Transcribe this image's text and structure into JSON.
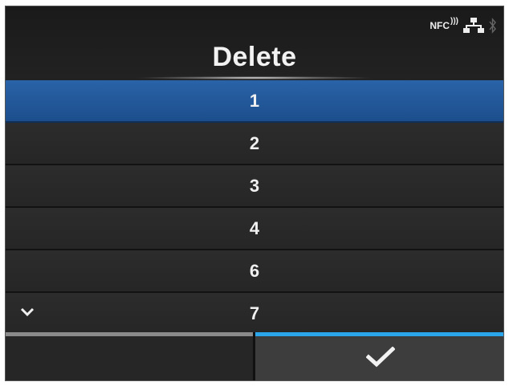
{
  "header": {
    "title": "Delete",
    "status": {
      "nfc_label": "NFC",
      "nfc_icon": "nfc-icon",
      "lan_icon": "network-icon",
      "bt_icon": "bluetooth-icon"
    }
  },
  "list": {
    "items": [
      {
        "label": "1",
        "selected": true
      },
      {
        "label": "2",
        "selected": false
      },
      {
        "label": "3",
        "selected": false
      },
      {
        "label": "4",
        "selected": false
      },
      {
        "label": "6",
        "selected": false
      },
      {
        "label": "7",
        "selected": false
      }
    ],
    "more_below_icon": "chevron-down-icon"
  },
  "footer": {
    "left_button_icon": "",
    "right_button_icon": "checkmark-icon"
  },
  "colors": {
    "background": "#1e1e1e",
    "selected_row": "#2a63a8",
    "accent": "#2ba6ea",
    "inactive_tab": "#8a8a8a"
  }
}
